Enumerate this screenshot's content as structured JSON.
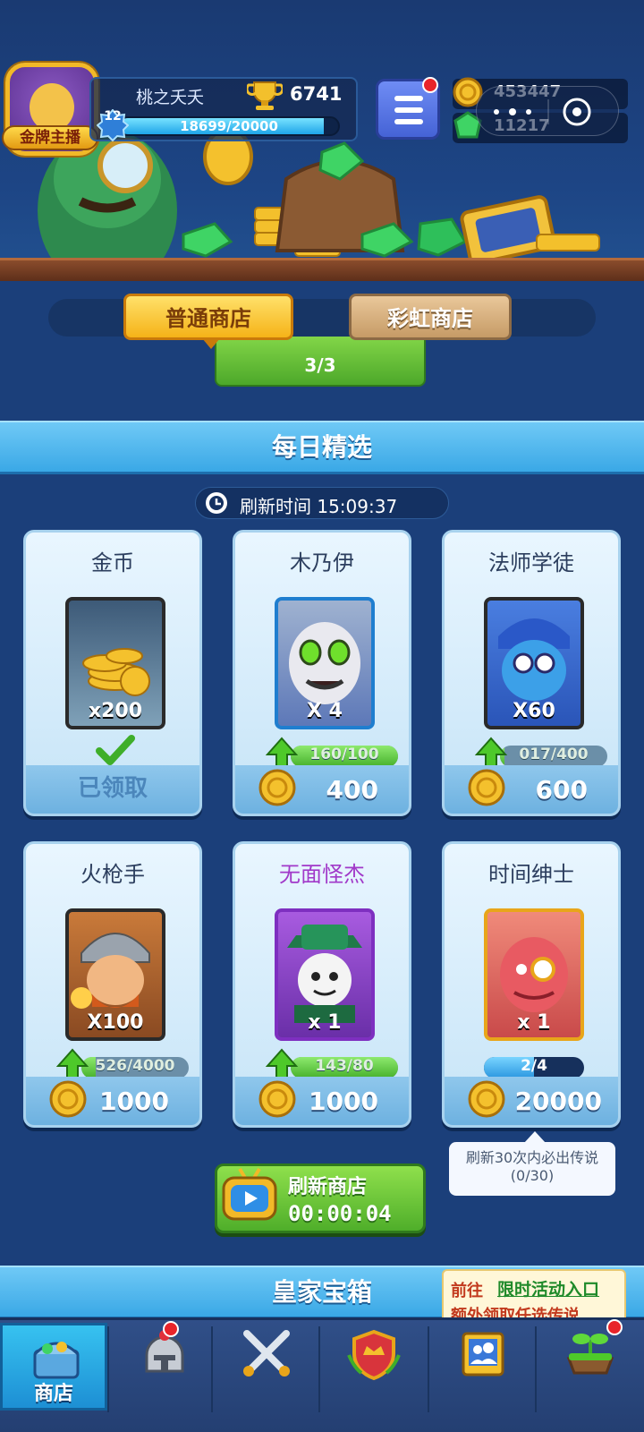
{
  "player": {
    "name": "桃之夭夭",
    "trophies": "6741",
    "level": "12",
    "xp_text": "18699/20000",
    "xp_fraction": 0.935,
    "badge": "金牌主播"
  },
  "currency": {
    "coins": "453447",
    "gems": "11217"
  },
  "tabs": {
    "normal": "普通商店",
    "rainbow": "彩虹商店"
  },
  "free_item": {
    "count": "3/3"
  },
  "daily": {
    "title": "每日精选",
    "refresh_label": "刷新时间 15:09:37",
    "cards": [
      {
        "title": "金币",
        "qty": "x200",
        "status": "已领取"
      },
      {
        "title": "木乃伊",
        "qty": "X 4",
        "progress": "160/100",
        "price": "400"
      },
      {
        "title": "法师学徒",
        "qty": "X60",
        "progress": "017/400",
        "price": "600"
      },
      {
        "title": "火枪手",
        "qty": "X100",
        "progress": "526/4000",
        "price": "1000"
      },
      {
        "title": "无面怪杰",
        "qty": "x 1",
        "progress": "143/80",
        "price": "1000"
      },
      {
        "title": "时间绅士",
        "qty": "x 1",
        "progress": "2/4",
        "price": "20000"
      }
    ],
    "tooltip_line1": "刷新30次内必出传说",
    "tooltip_line2": "(0/30)"
  },
  "refresh_store": {
    "label": "刷新商店",
    "timer": "00:00:04"
  },
  "royal": {
    "title": "皇家宝箱",
    "event_go": "前往",
    "event_title": "限时活动入口",
    "event_sub": "额外领取任选传说"
  },
  "nav": {
    "shop": "商店"
  },
  "colors": {
    "background": "#1b3f7a",
    "section_header": "#3aa8e6",
    "tab_active": "#f5b318",
    "green_button": "#4fae2a",
    "badge_red": "#e8242a"
  }
}
